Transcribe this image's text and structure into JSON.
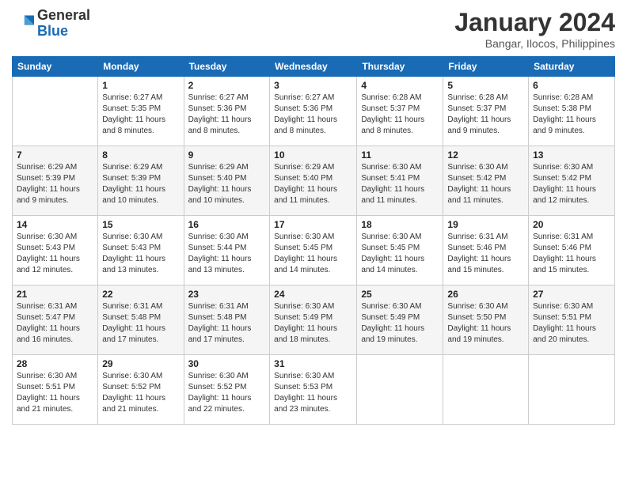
{
  "logo": {
    "text_general": "General",
    "text_blue": "Blue"
  },
  "title": "January 2024",
  "location": "Bangar, Ilocos, Philippines",
  "header_days": [
    "Sunday",
    "Monday",
    "Tuesday",
    "Wednesday",
    "Thursday",
    "Friday",
    "Saturday"
  ],
  "weeks": [
    [
      {
        "day": "",
        "sunrise": "",
        "sunset": "",
        "daylight": ""
      },
      {
        "day": "1",
        "sunrise": "Sunrise: 6:27 AM",
        "sunset": "Sunset: 5:35 PM",
        "daylight": "Daylight: 11 hours and 8 minutes."
      },
      {
        "day": "2",
        "sunrise": "Sunrise: 6:27 AM",
        "sunset": "Sunset: 5:36 PM",
        "daylight": "Daylight: 11 hours and 8 minutes."
      },
      {
        "day": "3",
        "sunrise": "Sunrise: 6:27 AM",
        "sunset": "Sunset: 5:36 PM",
        "daylight": "Daylight: 11 hours and 8 minutes."
      },
      {
        "day": "4",
        "sunrise": "Sunrise: 6:28 AM",
        "sunset": "Sunset: 5:37 PM",
        "daylight": "Daylight: 11 hours and 8 minutes."
      },
      {
        "day": "5",
        "sunrise": "Sunrise: 6:28 AM",
        "sunset": "Sunset: 5:37 PM",
        "daylight": "Daylight: 11 hours and 9 minutes."
      },
      {
        "day": "6",
        "sunrise": "Sunrise: 6:28 AM",
        "sunset": "Sunset: 5:38 PM",
        "daylight": "Daylight: 11 hours and 9 minutes."
      }
    ],
    [
      {
        "day": "7",
        "sunrise": "Sunrise: 6:29 AM",
        "sunset": "Sunset: 5:39 PM",
        "daylight": "Daylight: 11 hours and 9 minutes."
      },
      {
        "day": "8",
        "sunrise": "Sunrise: 6:29 AM",
        "sunset": "Sunset: 5:39 PM",
        "daylight": "Daylight: 11 hours and 10 minutes."
      },
      {
        "day": "9",
        "sunrise": "Sunrise: 6:29 AM",
        "sunset": "Sunset: 5:40 PM",
        "daylight": "Daylight: 11 hours and 10 minutes."
      },
      {
        "day": "10",
        "sunrise": "Sunrise: 6:29 AM",
        "sunset": "Sunset: 5:40 PM",
        "daylight": "Daylight: 11 hours and 11 minutes."
      },
      {
        "day": "11",
        "sunrise": "Sunrise: 6:30 AM",
        "sunset": "Sunset: 5:41 PM",
        "daylight": "Daylight: 11 hours and 11 minutes."
      },
      {
        "day": "12",
        "sunrise": "Sunrise: 6:30 AM",
        "sunset": "Sunset: 5:42 PM",
        "daylight": "Daylight: 11 hours and 11 minutes."
      },
      {
        "day": "13",
        "sunrise": "Sunrise: 6:30 AM",
        "sunset": "Sunset: 5:42 PM",
        "daylight": "Daylight: 11 hours and 12 minutes."
      }
    ],
    [
      {
        "day": "14",
        "sunrise": "Sunrise: 6:30 AM",
        "sunset": "Sunset: 5:43 PM",
        "daylight": "Daylight: 11 hours and 12 minutes."
      },
      {
        "day": "15",
        "sunrise": "Sunrise: 6:30 AM",
        "sunset": "Sunset: 5:43 PM",
        "daylight": "Daylight: 11 hours and 13 minutes."
      },
      {
        "day": "16",
        "sunrise": "Sunrise: 6:30 AM",
        "sunset": "Sunset: 5:44 PM",
        "daylight": "Daylight: 11 hours and 13 minutes."
      },
      {
        "day": "17",
        "sunrise": "Sunrise: 6:30 AM",
        "sunset": "Sunset: 5:45 PM",
        "daylight": "Daylight: 11 hours and 14 minutes."
      },
      {
        "day": "18",
        "sunrise": "Sunrise: 6:30 AM",
        "sunset": "Sunset: 5:45 PM",
        "daylight": "Daylight: 11 hours and 14 minutes."
      },
      {
        "day": "19",
        "sunrise": "Sunrise: 6:31 AM",
        "sunset": "Sunset: 5:46 PM",
        "daylight": "Daylight: 11 hours and 15 minutes."
      },
      {
        "day": "20",
        "sunrise": "Sunrise: 6:31 AM",
        "sunset": "Sunset: 5:46 PM",
        "daylight": "Daylight: 11 hours and 15 minutes."
      }
    ],
    [
      {
        "day": "21",
        "sunrise": "Sunrise: 6:31 AM",
        "sunset": "Sunset: 5:47 PM",
        "daylight": "Daylight: 11 hours and 16 minutes."
      },
      {
        "day": "22",
        "sunrise": "Sunrise: 6:31 AM",
        "sunset": "Sunset: 5:48 PM",
        "daylight": "Daylight: 11 hours and 17 minutes."
      },
      {
        "day": "23",
        "sunrise": "Sunrise: 6:31 AM",
        "sunset": "Sunset: 5:48 PM",
        "daylight": "Daylight: 11 hours and 17 minutes."
      },
      {
        "day": "24",
        "sunrise": "Sunrise: 6:30 AM",
        "sunset": "Sunset: 5:49 PM",
        "daylight": "Daylight: 11 hours and 18 minutes."
      },
      {
        "day": "25",
        "sunrise": "Sunrise: 6:30 AM",
        "sunset": "Sunset: 5:49 PM",
        "daylight": "Daylight: 11 hours and 19 minutes."
      },
      {
        "day": "26",
        "sunrise": "Sunrise: 6:30 AM",
        "sunset": "Sunset: 5:50 PM",
        "daylight": "Daylight: 11 hours and 19 minutes."
      },
      {
        "day": "27",
        "sunrise": "Sunrise: 6:30 AM",
        "sunset": "Sunset: 5:51 PM",
        "daylight": "Daylight: 11 hours and 20 minutes."
      }
    ],
    [
      {
        "day": "28",
        "sunrise": "Sunrise: 6:30 AM",
        "sunset": "Sunset: 5:51 PM",
        "daylight": "Daylight: 11 hours and 21 minutes."
      },
      {
        "day": "29",
        "sunrise": "Sunrise: 6:30 AM",
        "sunset": "Sunset: 5:52 PM",
        "daylight": "Daylight: 11 hours and 21 minutes."
      },
      {
        "day": "30",
        "sunrise": "Sunrise: 6:30 AM",
        "sunset": "Sunset: 5:52 PM",
        "daylight": "Daylight: 11 hours and 22 minutes."
      },
      {
        "day": "31",
        "sunrise": "Sunrise: 6:30 AM",
        "sunset": "Sunset: 5:53 PM",
        "daylight": "Daylight: 11 hours and 23 minutes."
      },
      {
        "day": "",
        "sunrise": "",
        "sunset": "",
        "daylight": ""
      },
      {
        "day": "",
        "sunrise": "",
        "sunset": "",
        "daylight": ""
      },
      {
        "day": "",
        "sunrise": "",
        "sunset": "",
        "daylight": ""
      }
    ]
  ]
}
